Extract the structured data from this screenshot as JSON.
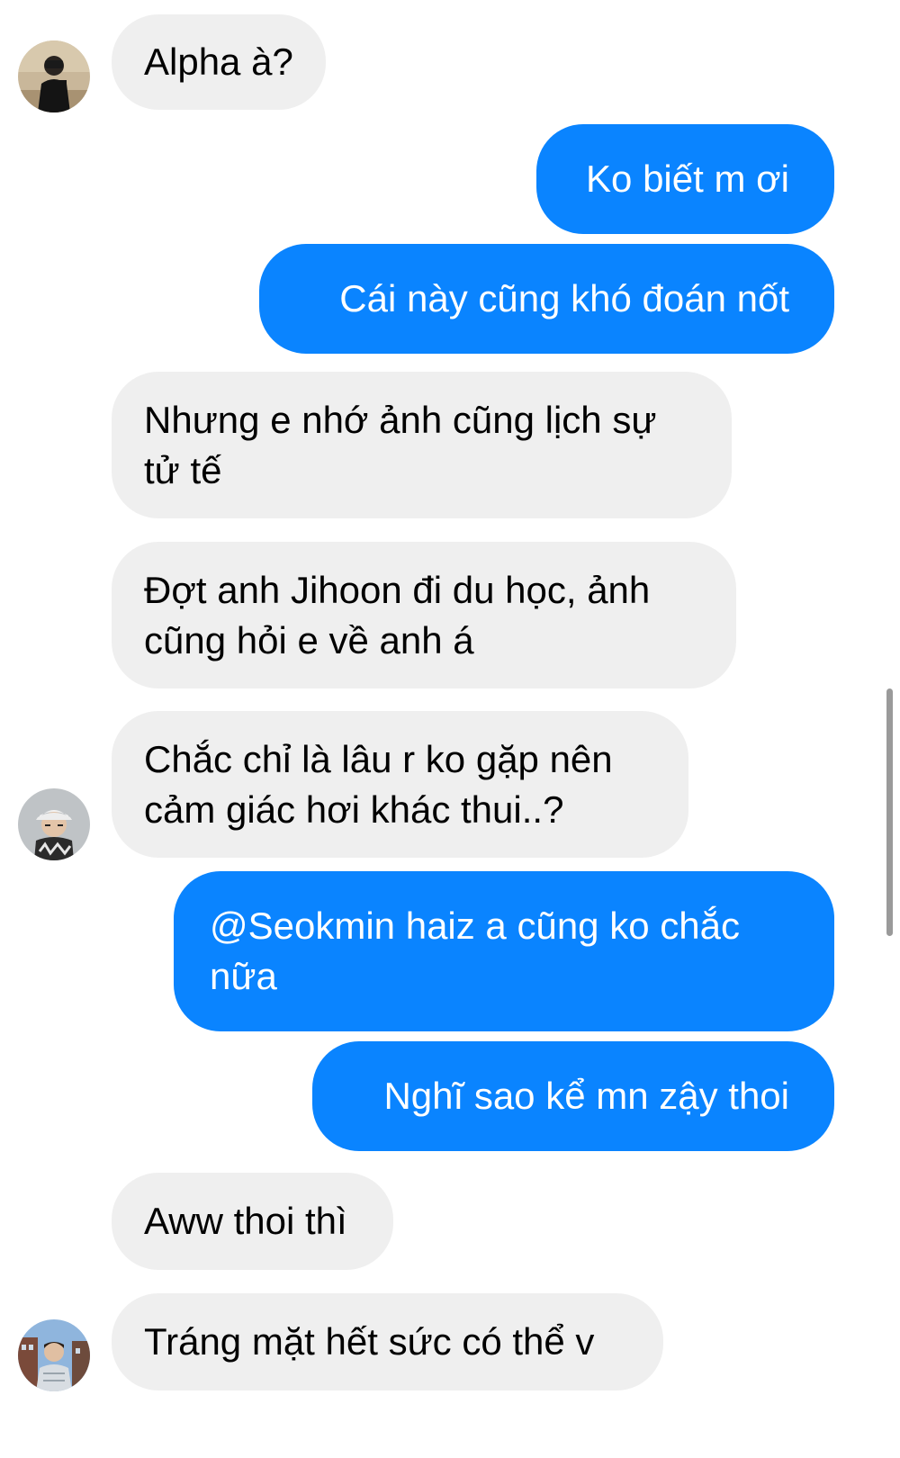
{
  "colors": {
    "incoming_bubble": "#efefef",
    "outgoing_bubble": "#0a84ff",
    "incoming_text": "#000000",
    "outgoing_text": "#ffffff"
  },
  "avatars": [
    {
      "icon": "photographer-avatar",
      "desc_icon": "person-with-camera"
    },
    {
      "icon": "cap-avatar",
      "desc_icon": "person-with-cap"
    },
    {
      "icon": "outdoor-avatar",
      "desc_icon": "person-outdoors"
    }
  ],
  "messages": [
    {
      "direction": "incoming",
      "text": "Alpha à?"
    },
    {
      "direction": "outgoing",
      "text": "Ko biết m ơi"
    },
    {
      "direction": "outgoing",
      "text": "Cái này cũng khó đoán nốt"
    },
    {
      "direction": "incoming",
      "text": "Nhưng e nhớ ảnh cũng lịch sự\ntử tế"
    },
    {
      "direction": "incoming",
      "text": "Đợt anh Jihoon đi du học, ảnh\ncũng hỏi e về anh á"
    },
    {
      "direction": "incoming",
      "text": "Chắc chỉ là lâu r ko gặp nên\ncảm giác hơi khác thui..?"
    },
    {
      "direction": "outgoing",
      "text": "@Seokmin haiz a cũng ko chắc\nnữa"
    },
    {
      "direction": "outgoing",
      "text": "Nghĩ sao kể mn zậy thoi"
    },
    {
      "direction": "incoming",
      "text": "Aww thoi thì"
    },
    {
      "direction": "incoming",
      "text": "Tráng mặt hết sức có thể v"
    }
  ]
}
